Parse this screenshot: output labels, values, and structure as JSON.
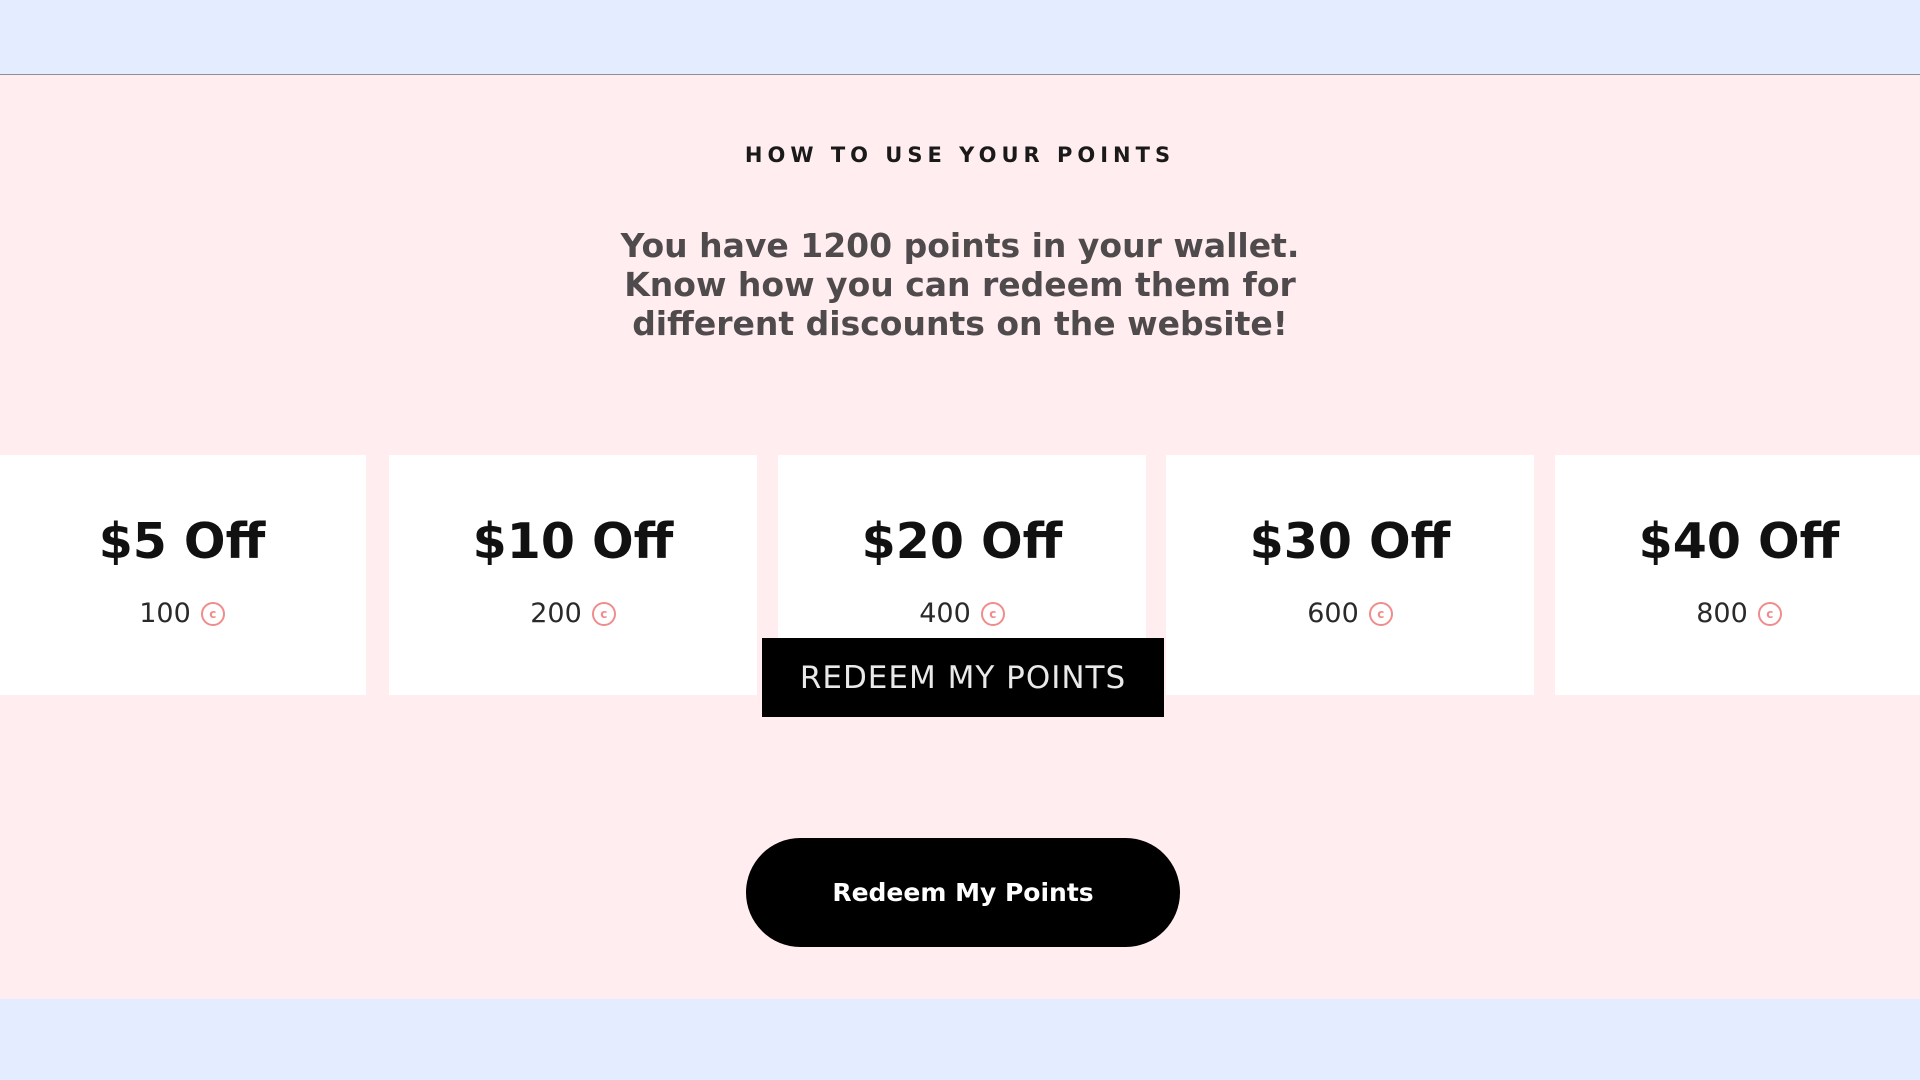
{
  "section": {
    "heading": "HOW TO USE YOUR POINTS",
    "lead_lines": [
      "You have 1200 points in your wallet.",
      "Know how you can redeem them for",
      "different discounts on the website!"
    ]
  },
  "rewards": [
    {
      "title": "$5 Off",
      "cost": "100",
      "icon": "points-coin-icon"
    },
    {
      "title": "$10 Off",
      "cost": "200",
      "icon": "points-coin-icon"
    },
    {
      "title": "$20 Off",
      "cost": "400",
      "icon": "points-coin-icon"
    },
    {
      "title": "$30 Off",
      "cost": "600",
      "icon": "points-coin-icon"
    },
    {
      "title": "$40 Off",
      "cost": "800",
      "icon": "points-coin-icon"
    }
  ],
  "tooltip": {
    "label": "REDEEM MY POINTS"
  },
  "cta": {
    "label": "Redeem My Points"
  },
  "colors": {
    "page_background": "#e3edff",
    "section_background": "#ffedf0",
    "card_background": "#ffffff",
    "coin_accent": "#f08c8c",
    "button": "#000000"
  }
}
